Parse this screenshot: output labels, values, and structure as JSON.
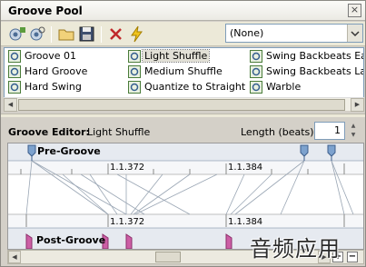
{
  "window": {
    "title": "Groove Pool",
    "close_glyph": "×"
  },
  "toolbar": {
    "buttons": [
      {
        "name": "add-groove-icon"
      },
      {
        "name": "groove-settings-icon"
      },
      {
        "name": "open-folder-icon"
      },
      {
        "name": "save-icon"
      },
      {
        "name": "delete-icon"
      },
      {
        "name": "commit-groove-icon"
      }
    ],
    "dropdown_value": "(None)"
  },
  "grooves": [
    [
      "Groove 01",
      "Light Shuffle",
      "Swing Backbeats Early"
    ],
    [
      "Hard Groove",
      "Medium Shuffle",
      "Swing Backbeats Late"
    ],
    [
      "Hard Swing",
      "Quantize to Straight",
      "Warble"
    ]
  ],
  "selected_groove": "Light Shuffle",
  "editor": {
    "label": "Groove Editor:",
    "current": "Light Shuffle",
    "length_label": "Length (beats):",
    "length_value": "1"
  },
  "pre_groove": {
    "label": "Pre-Groove",
    "ticks": [
      "1.1.372",
      "1.1.384"
    ]
  },
  "post_groove": {
    "label": "Post-Groove",
    "ticks": [
      "1.1.372",
      "1.1.384"
    ]
  },
  "watermark": "音频应用",
  "colors": {
    "accent": "#7da2ce",
    "post_marker": "#cc5fa5",
    "selection": "#e2e0d6"
  }
}
